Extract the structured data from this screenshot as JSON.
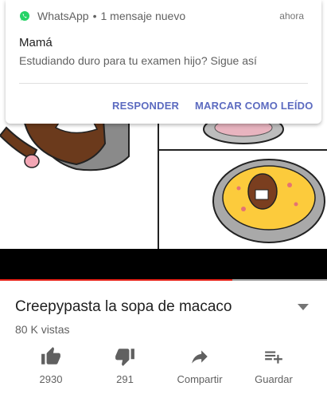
{
  "notification": {
    "app_name": "WhatsApp",
    "separator": "•",
    "subtitle": "1 mensaje nuevo",
    "time": "ahora",
    "sender": "Mamá",
    "message": "Estudiando duro para tu examen hijo? Sigue así",
    "actions": {
      "reply": "RESPONDER",
      "mark_read": "MARCAR COMO LEÍDO"
    },
    "app_color": "#25d366",
    "action_color": "#5c6bc0"
  },
  "video": {
    "progress_fraction": 0.71,
    "progress_color": "#e62117",
    "title": "Creepypasta la sopa de macaco",
    "views": "80 K vistas"
  },
  "actions": {
    "like": {
      "icon": "thumbs-up-icon",
      "label": "2930"
    },
    "dislike": {
      "icon": "thumbs-down-icon",
      "label": "291"
    },
    "share": {
      "icon": "share-icon",
      "label": "Compartir"
    },
    "save": {
      "icon": "playlist-add-icon",
      "label": "Guardar"
    }
  }
}
